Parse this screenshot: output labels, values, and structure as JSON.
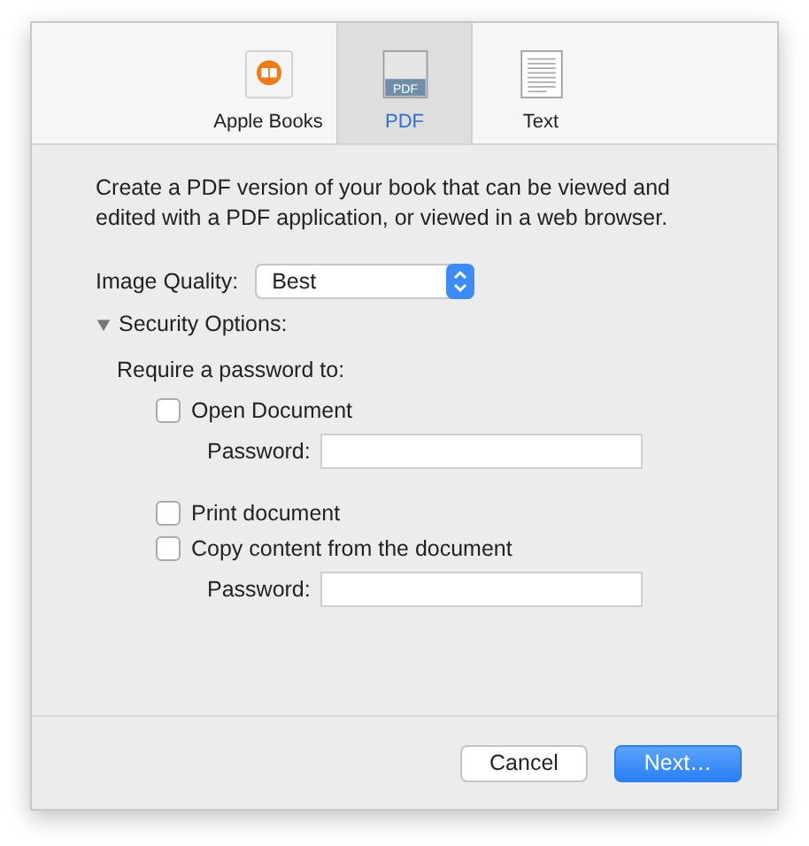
{
  "tabs": [
    {
      "label": "Apple Books",
      "kind": "books",
      "selected": false
    },
    {
      "label": "PDF",
      "kind": "pdf",
      "icon_text": "PDF",
      "selected": true
    },
    {
      "label": "Text",
      "kind": "text",
      "selected": false
    }
  ],
  "description": "Create a PDF version of your book that can be viewed and edited with a PDF application, or viewed in a web browser.",
  "image_quality": {
    "label": "Image Quality:",
    "value": "Best"
  },
  "security": {
    "label": "Security Options:",
    "expanded": true,
    "heading": "Require a password to:",
    "items": [
      {
        "kind": "checkbox",
        "label": "Open Document",
        "checked": false
      },
      {
        "kind": "password",
        "label": "Password:"
      },
      {
        "kind": "spacer"
      },
      {
        "kind": "checkbox",
        "label": "Print document",
        "checked": false
      },
      {
        "kind": "checkbox",
        "label": "Copy content from the document",
        "checked": false
      },
      {
        "kind": "password",
        "label": "Password:"
      }
    ]
  },
  "buttons": [
    {
      "label": "Cancel",
      "kind": "secondary"
    },
    {
      "label": "Next…",
      "kind": "primary"
    }
  ]
}
